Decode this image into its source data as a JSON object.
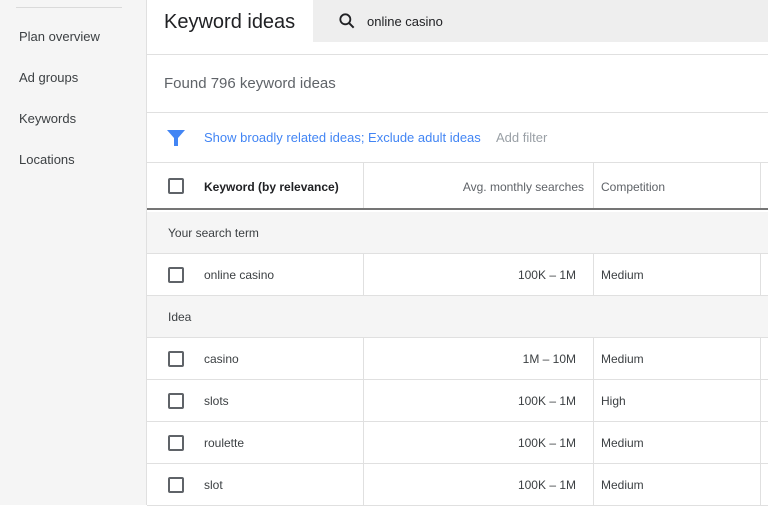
{
  "sidebar": {
    "items": [
      {
        "label": "Plan overview"
      },
      {
        "label": "Ad groups"
      },
      {
        "label": "Keywords"
      },
      {
        "label": "Locations"
      }
    ]
  },
  "header": {
    "title": "Keyword ideas",
    "search_value": "online casino"
  },
  "summary": "Found 796 keyword ideas",
  "filters": {
    "active": "Show broadly related ideas; Exclude adult ideas",
    "add_label": "Add filter"
  },
  "table": {
    "columns": [
      "Keyword (by relevance)",
      "Avg. monthly searches",
      "Competition"
    ],
    "sections": [
      {
        "label": "Your search term",
        "rows": [
          {
            "keyword": "online casino",
            "searches": "100K – 1M",
            "competition": "Medium"
          }
        ]
      },
      {
        "label": "Idea",
        "rows": [
          {
            "keyword": "casino",
            "searches": "1M – 10M",
            "competition": "Medium"
          },
          {
            "keyword": "slots",
            "searches": "100K – 1M",
            "competition": "High"
          },
          {
            "keyword": "roulette",
            "searches": "100K – 1M",
            "competition": "Medium"
          },
          {
            "keyword": "slot",
            "searches": "100K – 1M",
            "competition": "Medium"
          }
        ]
      }
    ]
  },
  "colors": {
    "accent": "#4285f4"
  }
}
